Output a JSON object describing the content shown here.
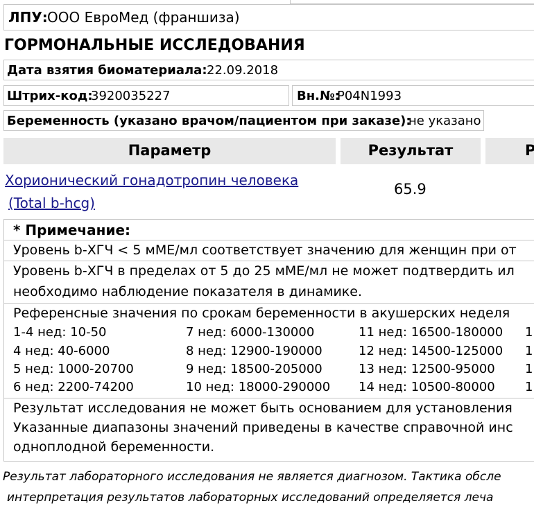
{
  "header": {
    "lpu_label": "ЛПУ:",
    "lpu_value": "ООО ЕвроМед (франшиза)"
  },
  "section_title": "ГОРМОНАЛЬНЫЕ ИССЛЕДОВАНИЯ",
  "fields": {
    "date_label": "Дата взятия биоматериала:",
    "date_value": "22.09.2018",
    "barcode_label": "Штрих-код:",
    "barcode_value": "3920035227",
    "int_no_label": "Вн.№:",
    "int_no_value": "P04N1993",
    "pregnancy_label": "Беременность (указано врачом/пациентом при заказе):",
    "pregnancy_value": "не указано"
  },
  "table": {
    "col_param": "Параметр",
    "col_result": "Результат",
    "col_ref": "Р",
    "row": {
      "param_line1": "Хорионический гонадотропин человека",
      "param_line2": "(Total b-hcg)",
      "result": "65.9"
    }
  },
  "note": {
    "title": "* Примечание:",
    "line1": "Уровень b-ХГЧ < 5 мМЕ/мл соответствует значению для женщин при от",
    "line2a": "Уровень b-ХГЧ в пределах от 5 до 25 мМЕ/мл не может подтвердить ил",
    "line2b": "необходимо наблюдение показателя в динамике.",
    "ref_title": "Референсные значения по срокам беременности в акушерских неделя",
    "ref_col1": [
      "1-4 нед: 10-50",
      "4 нед: 40-6000",
      "5 нед: 1000-20700",
      "6 нед: 2200-74200"
    ],
    "ref_col2": [
      "7 нед: 6000-130000",
      "8 нед: 12900-190000",
      "9 нед: 18500-205000",
      "10 нед: 18000-290000"
    ],
    "ref_col3": [
      "11 нед: 16500-180000",
      "12 нед: 14500-125000",
      "13 нед: 12500-95000",
      "14 нед: 10500-80000"
    ],
    "ref_col4": [
      "1",
      "1",
      "1",
      "1"
    ],
    "final_line1": "Результат исследования не может быть основанием для установления",
    "final_line2": "Указанные диапазоны значений приведены в качестве справочной инс",
    "final_line3": "одноплодной беременности."
  },
  "footer": {
    "line1": "Результат лабораторного исследования не является диагнозом. Тактика обсле",
    "line2": "интерпретация результатов лабораторных исследований определяется леча"
  }
}
